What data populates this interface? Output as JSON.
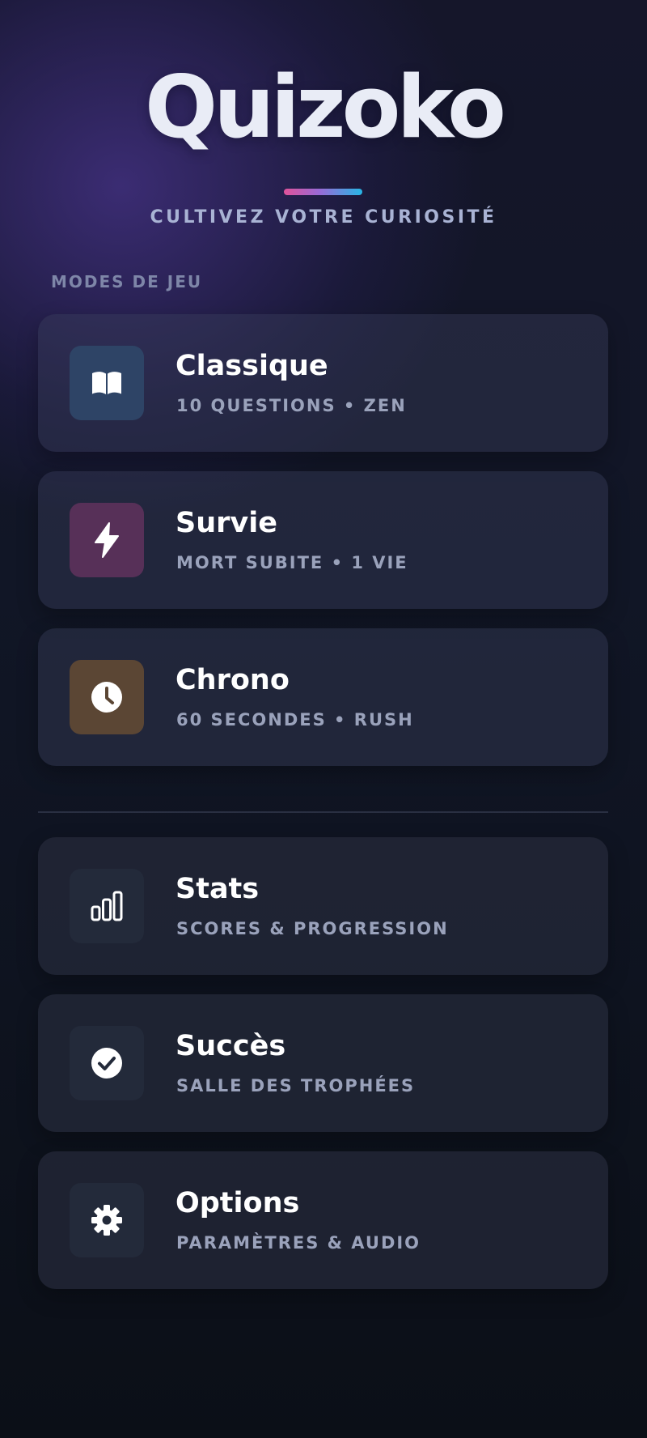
{
  "app": {
    "logo": "Quizoko",
    "tagline": "CULTIVEZ VOTRE CURIOSITÉ"
  },
  "modes": {
    "section_title": "MODES DE JEU",
    "items": [
      {
        "title": "Classique",
        "subtitle": "10 QUESTIONS • ZEN",
        "icon": "open-book-icon",
        "icon_bg": "#2e4466"
      },
      {
        "title": "Survie",
        "subtitle": "MORT SUBITE • 1 VIE",
        "icon": "lightning-bolt-icon",
        "icon_bg": "#573058"
      },
      {
        "title": "Chrono",
        "subtitle": "60 SECONDES • RUSH",
        "icon": "clock-icon",
        "icon_bg": "#5b4634"
      }
    ]
  },
  "menu": {
    "items": [
      {
        "title": "Stats",
        "subtitle": "SCORES & PROGRESSION",
        "icon": "bar-chart-icon",
        "icon_bg": "#232a3a"
      },
      {
        "title": "Succès",
        "subtitle": "SALLE DES TROPHÉES",
        "icon": "check-circle-icon",
        "icon_bg": "#232a3a"
      },
      {
        "title": "Options",
        "subtitle": "PARAMÈTRES & AUDIO",
        "icon": "gear-icon",
        "icon_bg": "#232a3a"
      }
    ]
  },
  "colors": {
    "accent_gradient": [
      "#e0539a",
      "#9a6ad6",
      "#27b6e6"
    ],
    "background_top": "#15162a",
    "background_bottom": "#0b0f17",
    "text_primary": "#ffffff",
    "text_secondary": "#9aa2bb",
    "section_label": "#7e86a8"
  }
}
